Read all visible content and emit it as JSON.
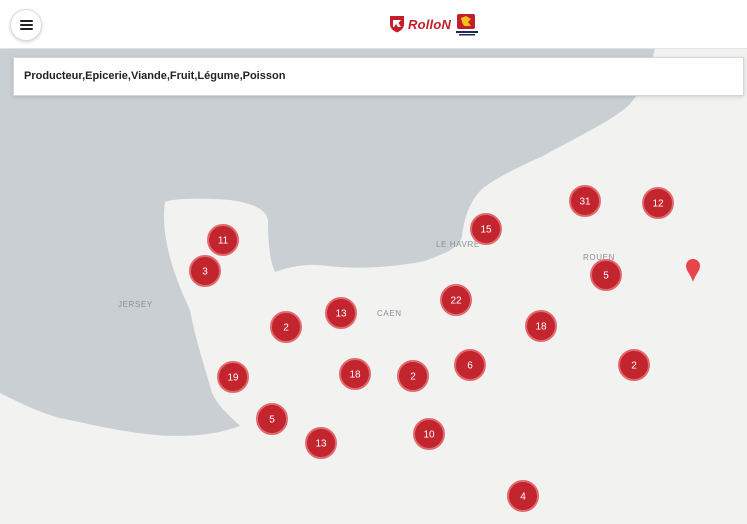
{
  "header": {
    "menu_icon": "hamburger-menu-icon",
    "brand_text": "RolloN",
    "region_logo_icon": "normandie-region-logo-icon",
    "colors": {
      "brand": "#c41e2b"
    }
  },
  "search": {
    "value": "Producteur,Epicerie,Viande,Fruit,Légume,Poisson"
  },
  "map": {
    "labels": {
      "jersey": "JERSEY",
      "le_havre": "LE HAVRE",
      "caen": "CAEN",
      "rouen": "ROUEN"
    },
    "marker_icon": "map-pin-icon",
    "colors": {
      "land": "#f2f2f0",
      "sea": "#c9cfd3",
      "cluster": "#c3252e"
    },
    "clusters": [
      {
        "id": "c1",
        "count": "11"
      },
      {
        "id": "c2",
        "count": "3"
      },
      {
        "id": "c3",
        "count": "2"
      },
      {
        "id": "c4",
        "count": "13"
      },
      {
        "id": "c5",
        "count": "15"
      },
      {
        "id": "c6",
        "count": "31"
      },
      {
        "id": "c7",
        "count": "12"
      },
      {
        "id": "c8",
        "count": "5"
      },
      {
        "id": "c9",
        "count": "22"
      },
      {
        "id": "c10",
        "count": "18"
      },
      {
        "id": "c11",
        "count": "19"
      },
      {
        "id": "c12",
        "count": "18"
      },
      {
        "id": "c13",
        "count": "2"
      },
      {
        "id": "c14",
        "count": "6"
      },
      {
        "id": "c15",
        "count": "2"
      },
      {
        "id": "c16",
        "count": "5"
      },
      {
        "id": "c17",
        "count": "13"
      },
      {
        "id": "c18",
        "count": "10"
      },
      {
        "id": "c19",
        "count": "4"
      }
    ]
  }
}
